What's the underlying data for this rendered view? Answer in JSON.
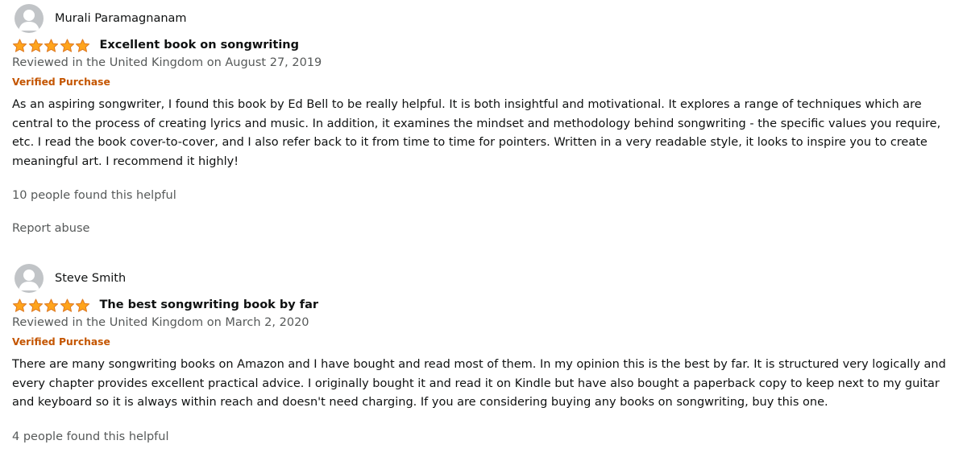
{
  "reviews": [
    {
      "reviewer": "Murali Paramagnanam",
      "rating": 5,
      "max_rating": 5,
      "title": "Excellent book on songwriting",
      "date_line": "Reviewed in the United Kingdom on August 27, 2019",
      "verified": "Verified Purchase",
      "body": "As an aspiring songwriter, I found this book by Ed Bell to be really helpful. It is both insightful and motivational. It explores a range of techniques which are central to the process of creating lyrics and music. In addition, it examines the mindset and methodology behind songwriting - the specific values you require, etc. I read the book cover-to-cover, and I also refer back to it from time to time for pointers. Written in a very readable style, it looks to inspire you to create meaningful art. I recommend it highly!",
      "helpful": "10 people found this helpful",
      "report": "Report abuse"
    },
    {
      "reviewer": "Steve Smith",
      "rating": 5,
      "max_rating": 5,
      "title": "The best songwriting book by far",
      "date_line": "Reviewed in the United Kingdom on March 2, 2020",
      "verified": "Verified Purchase",
      "body": "There are many songwriting books on Amazon and I have bought and read most of them. In my opinion this is the best by far. It is structured very logically and every chapter provides excellent practical advice. I originally bought it and read it on Kindle but have also bought a paperback copy to keep next to my guitar and keyboard so it is always within reach and doesn't need charging. If you are considering buying any books on songwriting, buy this one.",
      "helpful": "4 people found this helpful"
    }
  ],
  "colors": {
    "star_fill": "#ffa41c",
    "star_stroke": "#de7921",
    "verified": "#c45500",
    "secondary_text": "#565959",
    "avatar_bg": "#c1c4c7"
  },
  "icons": {
    "avatar": "default-user-avatar-icon",
    "star": "filled-star-icon"
  }
}
